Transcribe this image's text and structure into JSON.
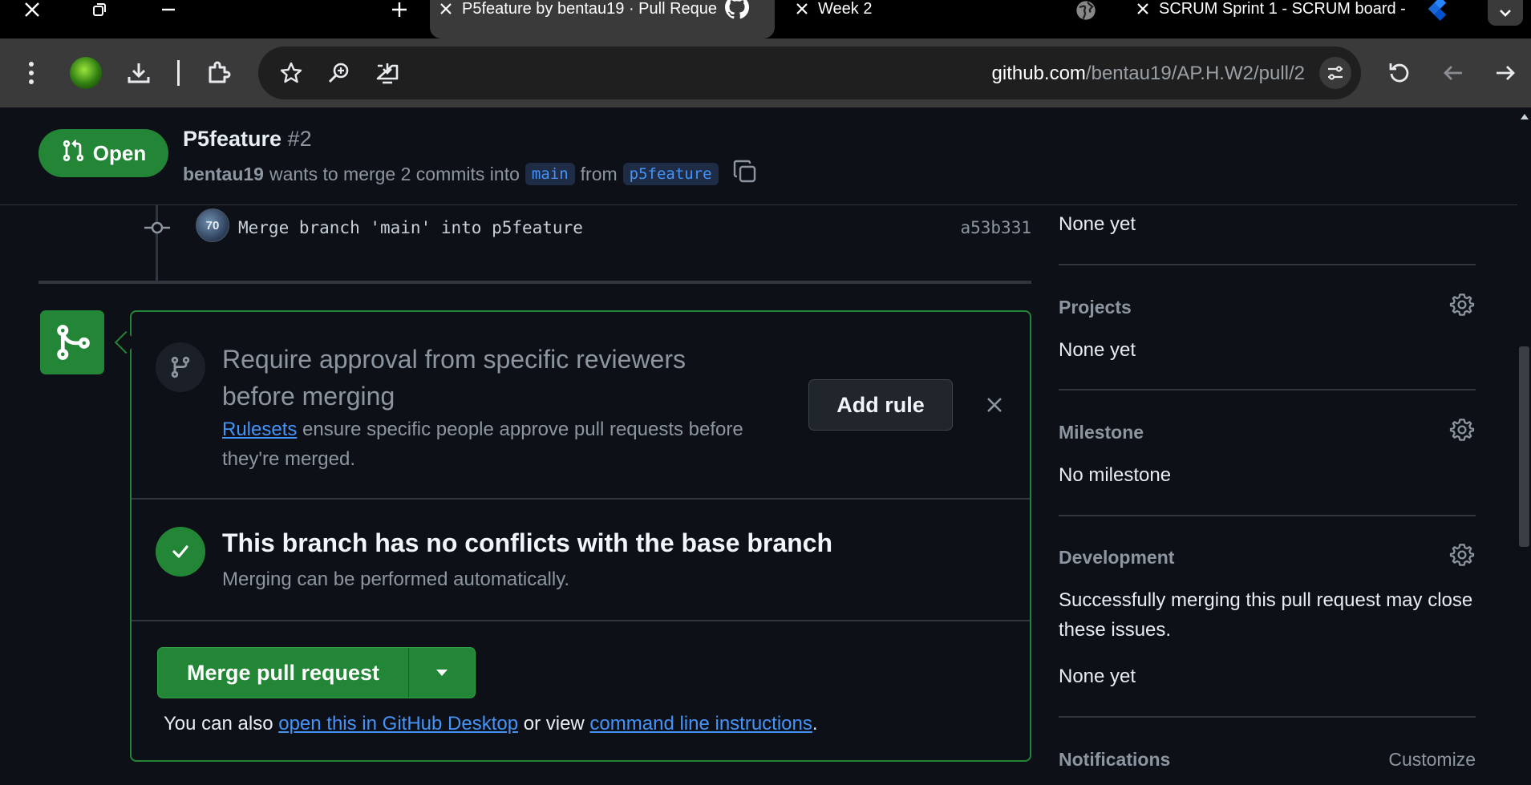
{
  "browser": {
    "tabs": [
      {
        "title": "P5feature by bentau19 · Pull Reque",
        "active": true,
        "favicon": "github-icon"
      },
      {
        "title": "Week 2",
        "active": false,
        "favicon": "globe-icon"
      },
      {
        "title": "SCRUM Sprint 1 - SCRUM board -",
        "active": false,
        "favicon": "jira-icon"
      }
    ],
    "url_host": "github.com",
    "url_path": "/bentau19/AP.H.W2/pull/2"
  },
  "pr": {
    "state": "Open",
    "title": "P5feature",
    "number": "#2",
    "author": "bentau19",
    "merge_text": "wants to merge 2 commits into",
    "base_branch": "main",
    "from_text": "from",
    "head_branch": "p5feature"
  },
  "commit": {
    "avatar_text": "70",
    "message": "Merge branch 'main' into p5feature",
    "sha": "a53b331"
  },
  "merge_box": {
    "rules_title": "Require approval from specific reviewers before merging",
    "rules_link": "Rulesets",
    "rules_desc": " ensure specific people approve pull requests before they're merged.",
    "add_rule_label": "Add rule",
    "conflicts_title": "This branch has no conflicts with the base branch",
    "conflicts_desc": "Merging can be performed automatically.",
    "merge_button_label": "Merge pull request",
    "alt_prefix": "You can also ",
    "alt_link_desktop": "open this in GitHub Desktop",
    "alt_middle": " or view ",
    "alt_link_cli": "command line instructions",
    "alt_suffix": "."
  },
  "sidebar": {
    "labels_value": "None yet",
    "projects_heading": "Projects",
    "projects_value": "None yet",
    "milestone_heading": "Milestone",
    "milestone_value": "No milestone",
    "development_heading": "Development",
    "development_desc": "Successfully merging this pull request may close these issues.",
    "development_value": "None yet",
    "notifications_heading": "Notifications",
    "customize_label": "Customize"
  },
  "colors": {
    "accent_green": "#238636",
    "link_blue": "#4493f8",
    "bg": "#0d1117"
  }
}
